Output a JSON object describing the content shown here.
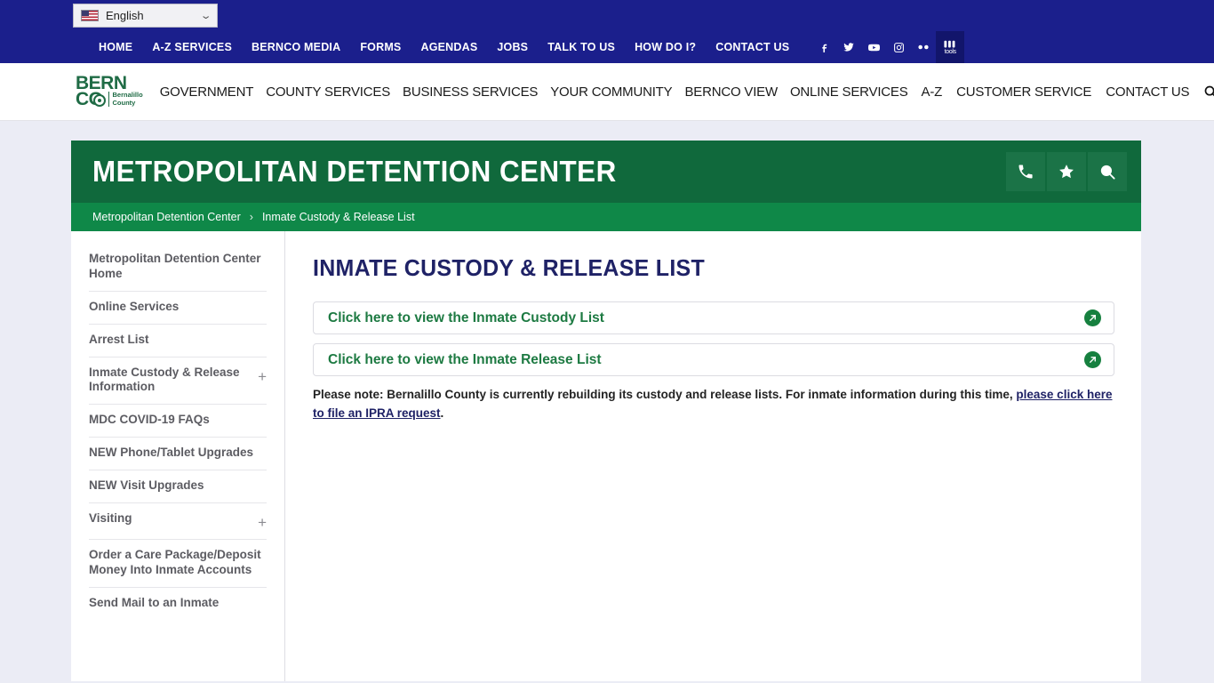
{
  "language_bar": {
    "selected": "English",
    "flag_icon": "us-flag-icon",
    "chevron_icon": "chevron-down-icon"
  },
  "utility_nav": {
    "items": [
      {
        "label": "HOME"
      },
      {
        "label": "A-Z SERVICES"
      },
      {
        "label": "BERNCO MEDIA"
      },
      {
        "label": "FORMS"
      },
      {
        "label": "AGENDAS"
      },
      {
        "label": "JOBS"
      },
      {
        "label": "TALK TO US"
      },
      {
        "label": "HOW DO I?"
      },
      {
        "label": "CONTACT US"
      }
    ],
    "social": [
      {
        "name": "facebook-icon"
      },
      {
        "name": "twitter-icon"
      },
      {
        "name": "youtube-icon"
      },
      {
        "name": "instagram-icon"
      },
      {
        "name": "flickr-icon"
      },
      {
        "name": "toolkit-icon",
        "label": "tools"
      }
    ]
  },
  "brand": {
    "line1": "BERN",
    "line2": "CO",
    "sub_line1": "Bernalillo",
    "sub_line2": "County"
  },
  "main_nav": {
    "items": [
      {
        "label": "GOVERNMENT"
      },
      {
        "label": "COUNTY SERVICES"
      },
      {
        "label": "BUSINESS SERVICES"
      },
      {
        "label": "YOUR COMMUNITY"
      },
      {
        "label": "BERNCO VIEW"
      },
      {
        "label": "ONLINE SERVICES"
      }
    ],
    "right_items": [
      {
        "label": "A-Z"
      },
      {
        "label": "CUSTOMER SERVICE"
      },
      {
        "label": "CONTACT US"
      }
    ],
    "search_icon": "search-icon"
  },
  "banner": {
    "title": "METROPOLITAN DETENTION CENTER",
    "icons": [
      {
        "name": "phone-icon"
      },
      {
        "name": "star-icon"
      },
      {
        "name": "search-icon"
      }
    ]
  },
  "breadcrumb": {
    "items": [
      {
        "label": "Metropolitan Detention Center"
      },
      {
        "label": "Inmate Custody & Release List"
      }
    ],
    "separator": "›"
  },
  "sidebar": {
    "items": [
      {
        "label": "Metropolitan Detention Center Home",
        "expandable": false
      },
      {
        "label": "Online Services",
        "expandable": false
      },
      {
        "label": "Arrest List",
        "expandable": false
      },
      {
        "label": "Inmate Custody & Release Information",
        "expandable": true,
        "expand_symbol": "+"
      },
      {
        "label": "MDC COVID-19 FAQs",
        "expandable": false
      },
      {
        "label": "NEW Phone/Tablet Upgrades",
        "expandable": false
      },
      {
        "label": "NEW Visit Upgrades",
        "expandable": false
      },
      {
        "label": "Visiting",
        "expandable": true,
        "expand_symbol": "+"
      },
      {
        "label": "Order a Care Package/Deposit Money Into Inmate Accounts",
        "expandable": false
      },
      {
        "label": "Send Mail to an Inmate",
        "expandable": false
      }
    ]
  },
  "content": {
    "heading": "INMATE CUSTODY & RELEASE LIST",
    "links": [
      {
        "label": "Click here to view the Inmate Custody List",
        "icon": "external-link-icon"
      },
      {
        "label": "Click here to view the Inmate Release List",
        "icon": "external-link-icon"
      }
    ],
    "note_prefix": "Please note: Bernalillo County is currently rebuilding its custody and release lists. For inmate information during this time, ",
    "note_link": "please click here to file an IPRA request",
    "note_suffix": "."
  },
  "colors": {
    "nav_blue": "#1b1f8c",
    "banner_green": "#10693c",
    "breadcrumb_green": "#0f8848",
    "link_green": "#1d7a42",
    "heading_navy": "#1f2266",
    "page_background": "#ebecf5"
  }
}
